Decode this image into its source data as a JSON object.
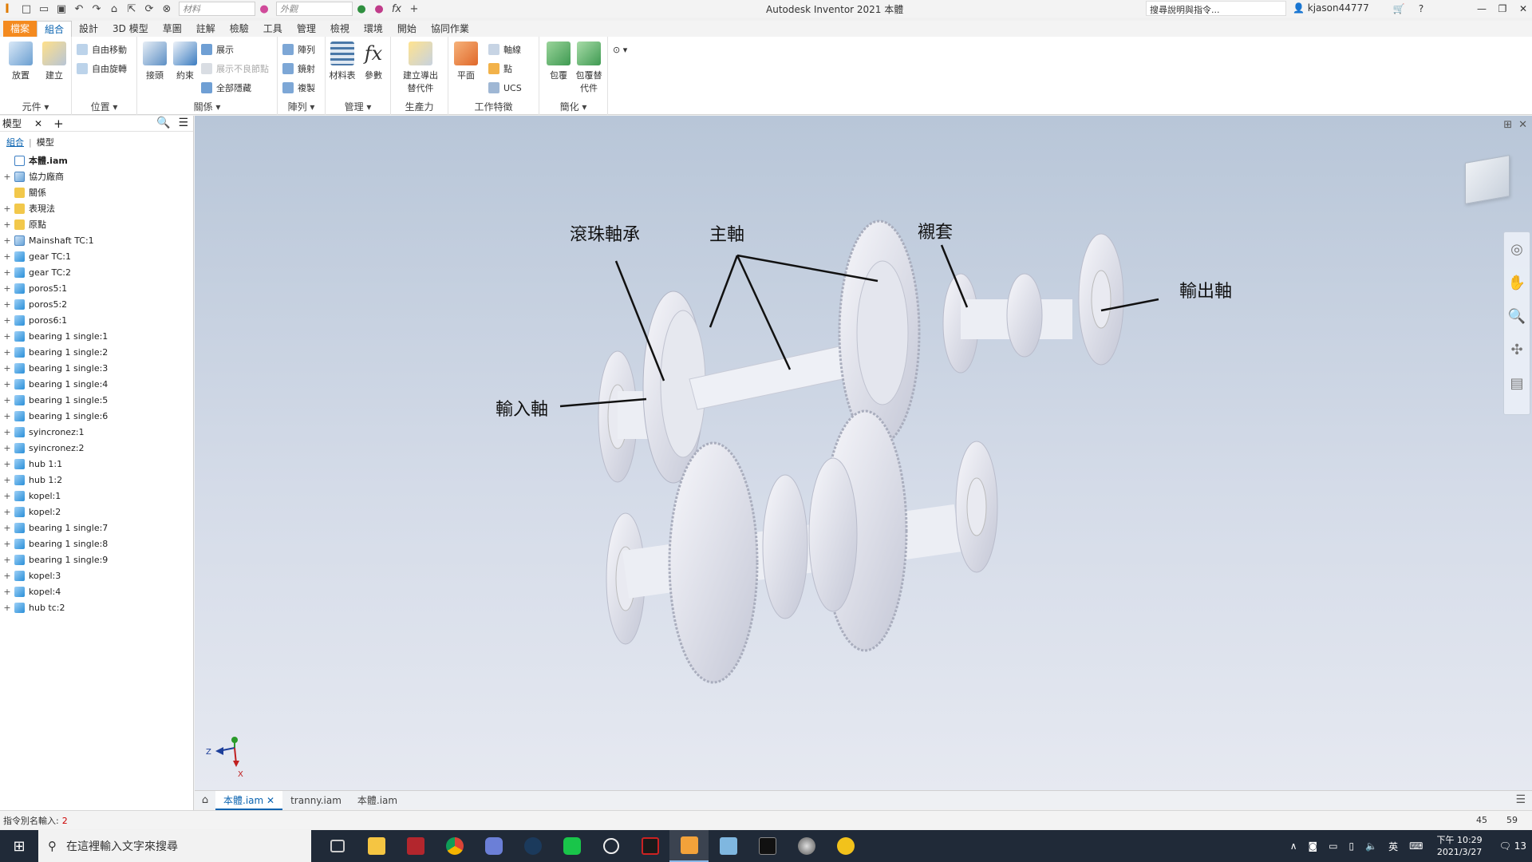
{
  "window": {
    "title": "Autodesk Inventor 2021   本體",
    "help_search": "搜尋說明與指令...",
    "user": "kjason44777",
    "material_placeholder": "材料",
    "appearance_placeholder": "外觀"
  },
  "tabs": [
    "檔案",
    "組合",
    "設計",
    "3D 模型",
    "草圖",
    "註解",
    "檢驗",
    "工具",
    "管理",
    "檢視",
    "環境",
    "開始",
    "協同作業"
  ],
  "active_tab": "組合",
  "ribbon": {
    "component": {
      "label": "元件 ▾",
      "place": "放置",
      "create": "建立"
    },
    "position": {
      "label": "位置 ▾",
      "free_move": "自由移動",
      "free_rotate": "自由旋轉"
    },
    "relationships": {
      "label": "關係 ▾",
      "joint": "接頭",
      "constrain": "約束",
      "show": "展示",
      "show_sick": "展示不良節點",
      "hide_all": "全部隱藏"
    },
    "pattern": {
      "label": "陣列 ▾",
      "pattern": "陣列",
      "mirror": "鏡射",
      "copy": "複製"
    },
    "manage": {
      "label": "管理 ▾",
      "bom": "材料表",
      "parameters": "參數"
    },
    "productivity": {
      "label": "生產力",
      "derive": "建立導出替代件"
    },
    "work_features": {
      "label": "工作特徵",
      "plane": "平面",
      "axis": "軸線",
      "point": "點",
      "ucs": "UCS"
    },
    "simplify": {
      "label": "簡化 ▾",
      "shrinkwrap": "包覆",
      "shrinkwrap_sub": "包覆替代件"
    }
  },
  "browser": {
    "title": "模型",
    "sub_assembly": "組合",
    "sub_modeling": "模型",
    "items": [
      {
        "label": "本體.iam",
        "icon": "asm",
        "root": true
      },
      {
        "label": "協力廠商",
        "icon": "rel"
      },
      {
        "label": "關係",
        "icon": "folder"
      },
      {
        "label": "表現法",
        "icon": "folder"
      },
      {
        "label": "原點",
        "icon": "folder"
      },
      {
        "label": "Mainshaft TC:1",
        "icon": "rel"
      },
      {
        "label": "gear TC:1",
        "icon": "part"
      },
      {
        "label": "gear TC:2",
        "icon": "part"
      },
      {
        "label": "poros5:1",
        "icon": "part"
      },
      {
        "label": "poros5:2",
        "icon": "part"
      },
      {
        "label": "poros6:1",
        "icon": "part"
      },
      {
        "label": "bearing 1 single:1",
        "icon": "part"
      },
      {
        "label": "bearing 1 single:2",
        "icon": "part"
      },
      {
        "label": "bearing 1 single:3",
        "icon": "part"
      },
      {
        "label": "bearing 1 single:4",
        "icon": "part"
      },
      {
        "label": "bearing 1 single:5",
        "icon": "part"
      },
      {
        "label": "bearing 1 single:6",
        "icon": "part"
      },
      {
        "label": "syincronez:1",
        "icon": "part"
      },
      {
        "label": "syincronez:2",
        "icon": "part"
      },
      {
        "label": "hub 1:1",
        "icon": "part"
      },
      {
        "label": "hub 1:2",
        "icon": "part"
      },
      {
        "label": "kopel:1",
        "icon": "part"
      },
      {
        "label": "kopel:2",
        "icon": "part"
      },
      {
        "label": "bearing 1 single:7",
        "icon": "part"
      },
      {
        "label": "bearing 1 single:8",
        "icon": "part"
      },
      {
        "label": "bearing 1 single:9",
        "icon": "part"
      },
      {
        "label": "kopel:3",
        "icon": "part"
      },
      {
        "label": "kopel:4",
        "icon": "part"
      },
      {
        "label": "hub tc:2",
        "icon": "part"
      }
    ]
  },
  "viewport": {
    "callouts": {
      "ball_bearing": "滾珠軸承",
      "main_shaft": "主軸",
      "bushing": "襯套",
      "output_shaft": "輸出軸",
      "input_shaft": "輸入軸"
    },
    "triad": {
      "z": "Z",
      "x": "X"
    }
  },
  "doc_tabs": [
    "本體.iam",
    "tranny.iam",
    "本體.iam"
  ],
  "status": {
    "prompt": "指令別名輸入:",
    "value": "2",
    "count_a": "45",
    "count_b": "59"
  },
  "taskbar": {
    "search_placeholder": "在這裡輸入文字來搜尋",
    "ime": "英",
    "time": "下午 10:29",
    "date": "2021/3/27",
    "notifications": "13"
  },
  "colors": {
    "file_tab": "#f48a1f",
    "accent": "#0a63b0",
    "taskbar": "#202a38",
    "viewport_top": "#b8c6d8",
    "viewport_bottom": "#e6e9f1"
  }
}
